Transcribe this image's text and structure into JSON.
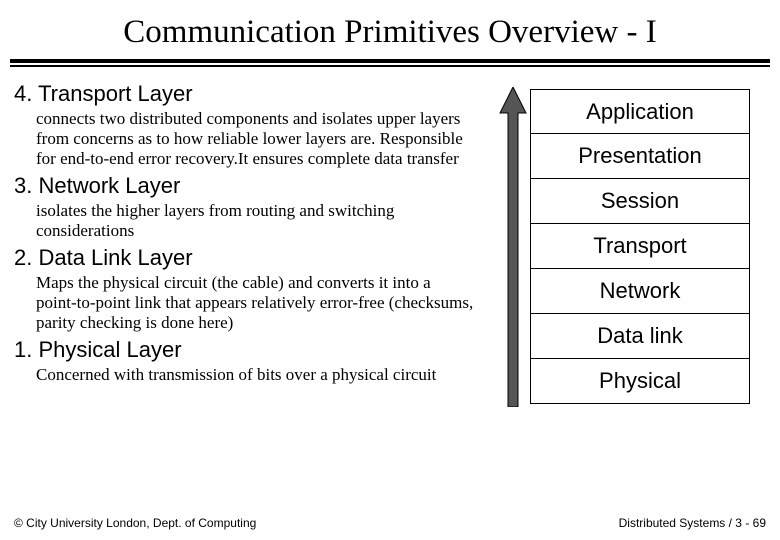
{
  "title": "Communication Primitives Overview - I",
  "sections": [
    {
      "heading": "4. Transport Layer",
      "body": "connects two distributed components and isolates upper layers from concerns as to how reliable lower layers are. Responsible for end-to-end error recovery.It ensures complete data transfer"
    },
    {
      "heading": "3. Network Layer",
      "body": "isolates the higher layers from routing and switching considerations"
    },
    {
      "heading": "2. Data Link Layer",
      "body": "Maps the physical circuit (the cable) and converts it into a point-to-point link that appears relatively error-free (checksums, parity checking is done here)"
    },
    {
      "heading": "1. Physical Layer",
      "body": "Concerned with transmission of bits over a physical circuit"
    }
  ],
  "stack": [
    "Application",
    "Presentation",
    "Session",
    "Transport",
    "Network",
    "Data link",
    "Physical"
  ],
  "footer": {
    "left": "© City University London, Dept. of Computing",
    "right": "Distributed Systems / 3 - 69"
  }
}
